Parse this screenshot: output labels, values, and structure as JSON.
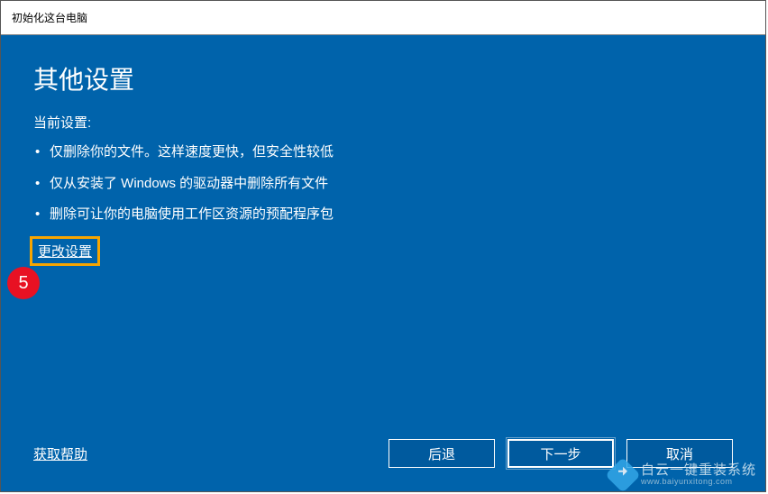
{
  "window": {
    "title": "初始化这台电脑"
  },
  "heading": "其他设置",
  "current_label": "当前设置:",
  "bullets": [
    "仅删除你的文件。这样速度更快，但安全性较低",
    "仅从安装了 Windows 的驱动器中删除所有文件",
    "删除可让你的电脑使用工作区资源的预配程序包"
  ],
  "change_settings": "更改设置",
  "step_badge": "5",
  "help_link": "获取帮助",
  "buttons": {
    "back": "后退",
    "next": "下一步",
    "cancel": "取消"
  },
  "watermark": {
    "main": "白云一键重装系统",
    "sub": "www.baiyunxitong.com"
  }
}
